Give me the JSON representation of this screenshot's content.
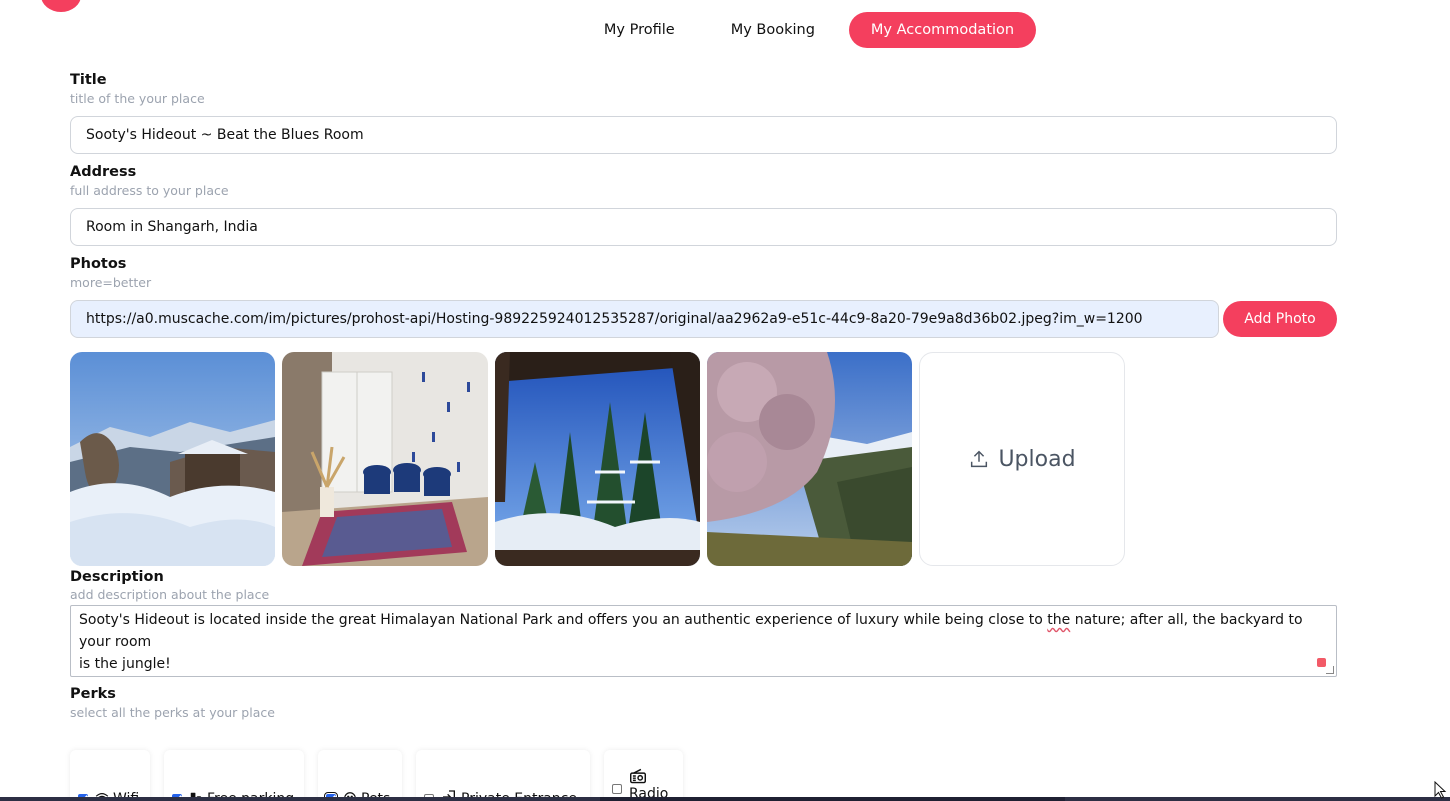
{
  "nav": {
    "tabs": [
      {
        "label": "My Profile",
        "active": false
      },
      {
        "label": "My Booking",
        "active": false
      },
      {
        "label": "My Accommodation",
        "active": true
      }
    ]
  },
  "form": {
    "title": {
      "heading": "Title",
      "hint": "title of the your place",
      "value": "Sooty's Hideout ~ Beat the Blues Room"
    },
    "address": {
      "heading": "Address",
      "hint": "full address to your place",
      "value": "Room in Shangarh, India"
    },
    "photos": {
      "heading": "Photos",
      "hint": "more=better",
      "link_value": "https://a0.muscache.com/im/pictures/prohost-api/Hosting-989225924012535287/original/aa2962a9-e51c-44c9-8a20-79e9a8d36b02.jpeg?im_w=1200",
      "add_button": "Add Photo",
      "upload_label": "Upload"
    },
    "description": {
      "heading": "Description",
      "hint": "add description about the place",
      "value_part1": "Sooty's Hideout is located inside the great Himalayan National Park and offers you an authentic experience of luxury while being close to ",
      "value_squiggle": "the",
      "value_part2": " nature; after all, the backyard to your room",
      "value_line2": "is the jungle!"
    },
    "perks": {
      "heading": "Perks",
      "hint": "select all the perks at your place",
      "items": [
        {
          "label": "Wifi",
          "checked": true,
          "icon": "wifi-icon"
        },
        {
          "label": "Free parking",
          "checked": true,
          "icon": "parking-icon"
        },
        {
          "label": "Pets",
          "checked": true,
          "icon": "pets-icon"
        },
        {
          "label": "Private Entrance",
          "checked": false,
          "icon": "entrance-icon"
        },
        {
          "label": "Radio",
          "checked": false,
          "icon": "radio-icon"
        }
      ]
    }
  },
  "colors": {
    "accent": "#f43f5e",
    "input_autofill": "#e8f0fe",
    "checkbox": "#2563eb"
  }
}
